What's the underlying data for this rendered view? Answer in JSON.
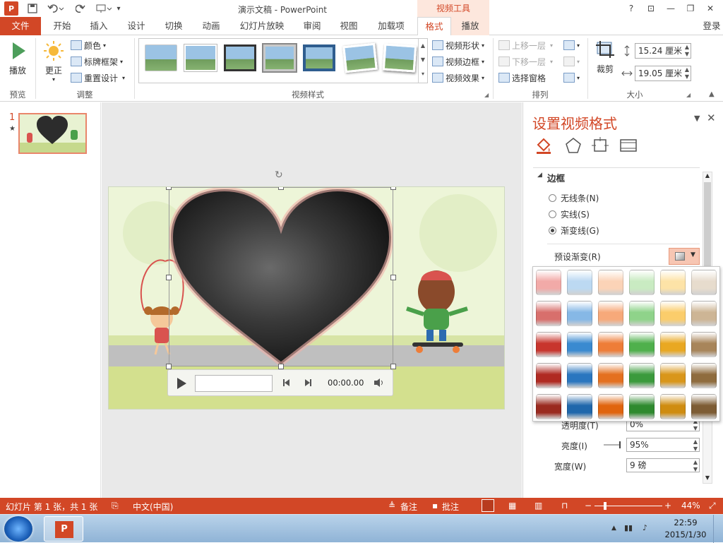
{
  "titlebar": {
    "app_icon_text": "P",
    "title": "演示文稿 - PowerPoint",
    "contextual_group": "视频工具",
    "help": "?",
    "restore_ribbon": "⊡",
    "minimize": "—",
    "maximize": "❐",
    "close": "✕"
  },
  "tabs": [
    "文件",
    "开始",
    "插入",
    "设计",
    "切换",
    "动画",
    "幻灯片放映",
    "审阅",
    "视图",
    "加载项",
    "格式",
    "播放"
  ],
  "login": "登录",
  "ribbon": {
    "preview": {
      "play_label": "播放",
      "group": "预览"
    },
    "adjust": {
      "correct_label": "更正",
      "color": "颜色",
      "poster_frame": "标牌框架",
      "reset_design": "重置设计",
      "group": "调整"
    },
    "video_styles": {
      "group": "视频样式",
      "shape": "视频形状",
      "border": "视频边框",
      "effects": "视频效果"
    },
    "arrange": {
      "bring_forward": "上移一层",
      "send_backward": "下移一层",
      "selection_pane": "选择窗格",
      "group": "排列"
    },
    "size": {
      "crop": "裁剪",
      "height": "15.24 厘米",
      "width": "19.05 厘米",
      "group": "大小"
    }
  },
  "thumbnails": {
    "number": "1",
    "star": "★"
  },
  "player": {
    "time": "00:00.00"
  },
  "panel": {
    "title": "设置视频格式",
    "section": "边框",
    "no_line": "无线条(N)",
    "solid_line": "实线(S)",
    "gradient_line": "渐变线(G)",
    "preset_gradient": "预设渐变(R)",
    "transparency_label": "透明度(T)",
    "transparency_value": "0%",
    "brightness_label": "亮度(I)",
    "brightness_value": "95%",
    "width_label": "宽度(W)",
    "width_value": "9 磅"
  },
  "gradient_presets": [
    [
      "#f2aaa8",
      "#bcd9f2",
      "#fbd3b7",
      "#c9ebc2",
      "#fde3a7",
      "#e7dccd"
    ],
    [
      "#d86f6c",
      "#86b8e6",
      "#f7a97a",
      "#8fd38a",
      "#fbcd6b",
      "#cdb595"
    ],
    [
      "#c8352d",
      "#3a8ad0",
      "#ee7d38",
      "#4fb04c",
      "#e9a822",
      "#a8855a"
    ],
    [
      "#b02a22",
      "#2a76bf",
      "#e4701f",
      "#3b9a3c",
      "#d9961a",
      "#8f6c3e"
    ],
    [
      "#9a2a1f",
      "#1f67ab",
      "#e0640e",
      "#2f8a2f",
      "#cf8c10",
      "#7d5c34"
    ]
  ],
  "statusbar": {
    "slide_info": "幻灯片 第 1 张，共 1 张",
    "language": "中文(中国)",
    "notes": "备注",
    "comments": "批注",
    "zoom": "44%"
  },
  "taskbar": {
    "time": "22:59",
    "date": "2015/1/30"
  },
  "colors": {
    "accent": "#d24726",
    "ribbon_tint": "#fde7dd"
  }
}
